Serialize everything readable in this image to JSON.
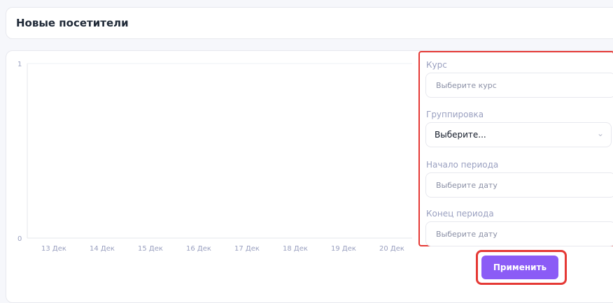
{
  "header": {
    "title": "Новые посетители"
  },
  "chart_data": {
    "type": "line",
    "categories": [
      "13 Дек",
      "14 Дек",
      "15 Дек",
      "16 Дек",
      "17 Дек",
      "18 Дек",
      "19 Дек",
      "20 Дек"
    ],
    "y_ticks": [
      "1",
      "0"
    ],
    "ylim": [
      0,
      1
    ],
    "series": [],
    "title": "",
    "xlabel": "",
    "ylabel": "",
    "grid": false
  },
  "filters": {
    "course": {
      "label": "Курс",
      "placeholder": "Выберите курс"
    },
    "grouping": {
      "label": "Группировка",
      "value": "Выберите..."
    },
    "start": {
      "label": "Начало периода",
      "placeholder": "Выберите дату"
    },
    "end": {
      "label": "Конец периода",
      "placeholder": "Выберите дату"
    }
  },
  "apply_button": {
    "label": "Применить"
  },
  "colors": {
    "accent": "#8b5cf6",
    "highlight": "#e53935",
    "axis_text": "#9aa0c0"
  }
}
